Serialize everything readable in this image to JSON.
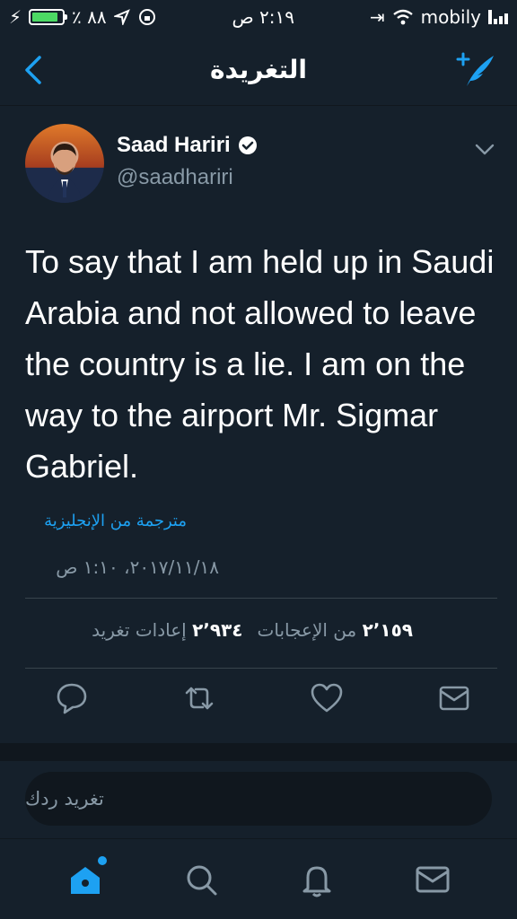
{
  "status_bar": {
    "battery_text": "٪ ٨٨",
    "time": "٢:١٩ ص",
    "carrier": "mobily",
    "battery_level": 0.88
  },
  "nav": {
    "title": "التغريدة"
  },
  "tweet": {
    "author_name": "Saad Hariri",
    "author_handle": "@saadhariri",
    "text": "To say that I am held up in Saudi Arabia and not allowed to leave the country is a lie. I am on the way to the airport Mr. Sigmar Gabriel.",
    "translated_label": "مترجمة من الإنجليزية",
    "timestamp": "٢٠١٧/١١/١٨، ١:١٠ ص",
    "retweets_count": "٢٬٩٣٤",
    "retweets_label": "إعادات تغريد",
    "likes_count": "٢٬١٥٩",
    "likes_label": "من الإعجابات"
  },
  "reply": {
    "placeholder": "تغريد ردك"
  },
  "colors": {
    "background": "#15202b",
    "accent": "#1da1f2",
    "muted": "#8899a6",
    "battery": "#4cd964"
  },
  "icons": [
    "back-icon",
    "compose-tweet-icon",
    "verified-icon",
    "chevron-down-icon",
    "reply-icon",
    "retweet-icon",
    "like-icon",
    "direct-message-icon",
    "home-icon",
    "search-icon",
    "notifications-icon",
    "messages-icon"
  ]
}
